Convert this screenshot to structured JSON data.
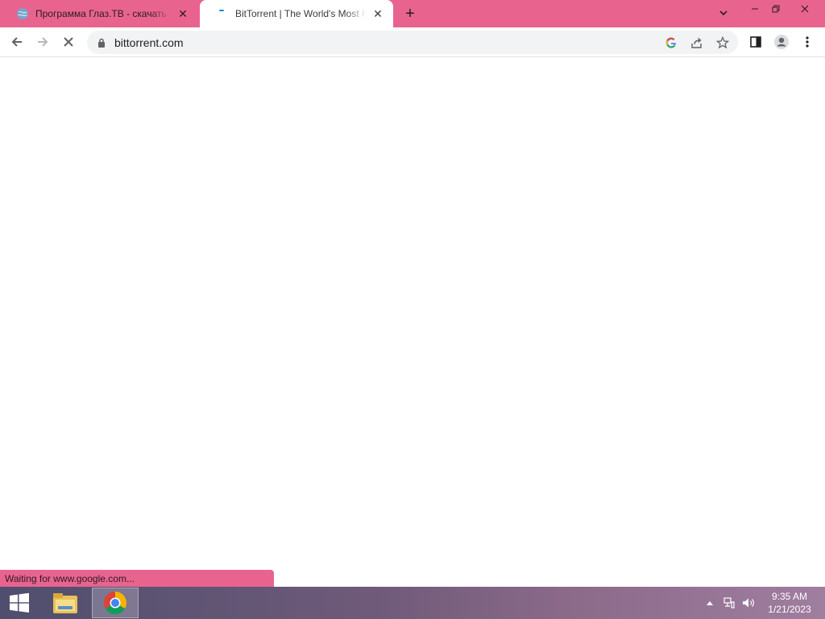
{
  "tabs": [
    {
      "title": "Программа Глаз.ТВ - скачать и",
      "close": "✕",
      "favicon": "globe-icon"
    },
    {
      "title": "BitTorrent | The World's Most Popular",
      "close": "✕",
      "favicon": "bittorrent-icon"
    }
  ],
  "tabstrip": {
    "new_tab": "+",
    "tab_search": "chevron-down-icon"
  },
  "window": {
    "minimize": "–",
    "restore": "❐",
    "close": "✕"
  },
  "toolbar": {
    "url": "bittorrent.com",
    "loading": true
  },
  "status": {
    "text": "Waiting for www.google.com..."
  },
  "taskbar": {
    "items": [
      "start-icon",
      "file-explorer-icon",
      "chrome-icon"
    ],
    "clock": {
      "time": "9:35 AM",
      "date": "1/21/2023"
    }
  },
  "colors": {
    "accent": "#e8648f",
    "toolbar": "#ffffff",
    "omnibox": "#f1f3f4"
  }
}
